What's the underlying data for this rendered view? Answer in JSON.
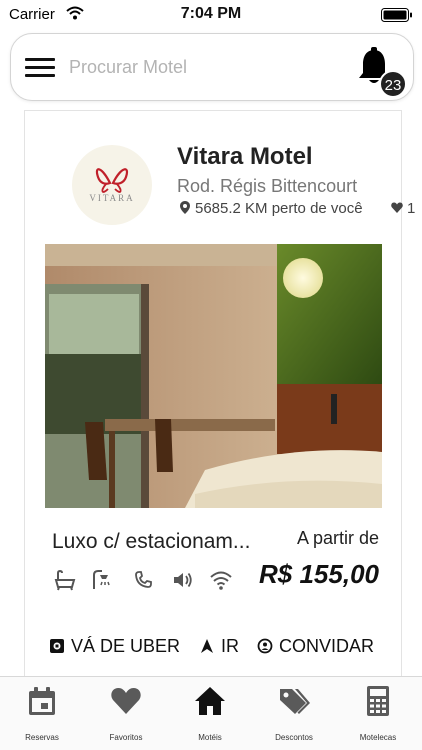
{
  "status_bar": {
    "carrier": "Carrier",
    "time": "7:04 PM"
  },
  "search": {
    "placeholder": "Procurar Motel",
    "menu_icon": "hamburger-icon",
    "notification_icon": "bell-icon",
    "notification_count": "23"
  },
  "listing": {
    "logo_text": "VITARA",
    "name": "Vitara Motel",
    "address": "Rod. Régis Bittencourt",
    "distance": "5685.2 KM perto de você",
    "favorites": "1",
    "room_name": "Luxo c/ estacionamento",
    "price_prefix": "A partir de",
    "price": "R$ 155,00",
    "amenities": [
      "bathtub-icon",
      "shower-icon",
      "phone-icon",
      "speaker-icon",
      "wifi-icon"
    ],
    "actions": {
      "uber": "VÁ DE UBER",
      "go": "IR",
      "invite": "CONVIDAR"
    }
  },
  "tabbar": {
    "tabs": [
      {
        "label": "Reservas",
        "icon": "calendar-icon"
      },
      {
        "label": "Favoritos",
        "icon": "heart-icon"
      },
      {
        "label": "Motéis",
        "icon": "home-icon",
        "active": true
      },
      {
        "label": "Descontos",
        "icon": "tags-icon"
      },
      {
        "label": "Motelecas",
        "icon": "calculator-icon"
      }
    ]
  },
  "colors": {
    "accent": "#111111",
    "muted_text": "#777777",
    "placeholder": "#b3b3b3",
    "logo_red": "#c0202a"
  }
}
